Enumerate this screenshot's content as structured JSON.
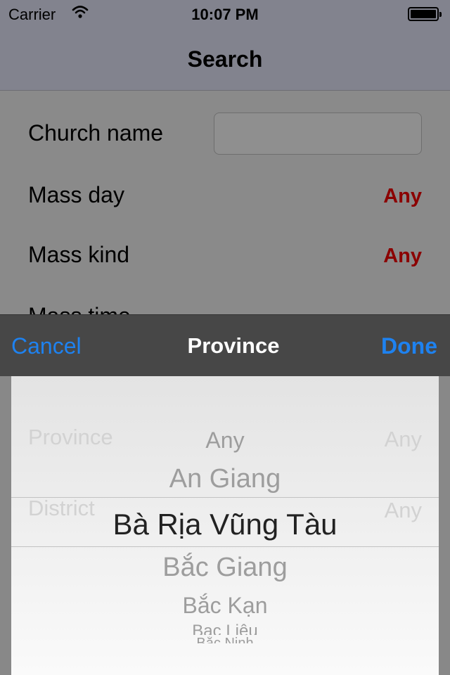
{
  "status_bar": {
    "carrier": "Carrier",
    "time": "10:07 PM"
  },
  "nav": {
    "title": "Search"
  },
  "form": {
    "church_name_label": "Church name",
    "church_name_value": "",
    "mass_day_label": "Mass day",
    "mass_day_value": "Any",
    "mass_kind_label": "Mass kind",
    "mass_kind_value": "Any",
    "mass_time_label": "Mass time",
    "province_label": "Province",
    "province_value": "Any",
    "district_label": "District",
    "district_value": "Any"
  },
  "toolbar": {
    "cancel": "Cancel",
    "title": "Province",
    "done": "Done"
  },
  "picker": {
    "options": [
      "Any",
      "An Giang",
      "Bà Rịa Vũng Tàu",
      "Bắc Giang",
      "Bắc Kạn",
      "Bạc Liêu",
      "Bắc Ninh"
    ],
    "selected": "Bà Rịa Vũng Tàu"
  },
  "colors": {
    "accent": "#1e82f0",
    "value_red": "#8b0000"
  },
  "icons": {
    "wifi": "wifi-icon",
    "battery": "battery-icon"
  }
}
